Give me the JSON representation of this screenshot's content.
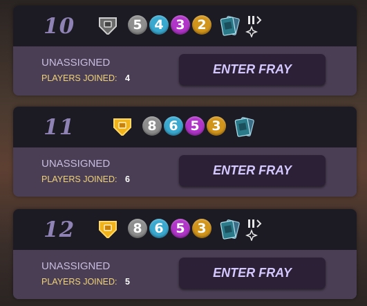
{
  "frays": [
    {
      "number": "10",
      "league_icon": "silver-league-shield-icon",
      "orbs": [
        {
          "value": "5",
          "color": "#8e8e8e"
        },
        {
          "value": "4",
          "color": "#3aa9d0"
        },
        {
          "value": "3",
          "color": "#b035c8"
        },
        {
          "value": "2",
          "color": "#d2951c"
        }
      ],
      "has_ruleset": true,
      "status": "UNASSIGNED",
      "players_label": "PLAYERS JOINED:",
      "players_count": "4",
      "button_label": "ENTER FRAY"
    },
    {
      "number": "11",
      "league_icon": "gold-league-shield-icon",
      "orbs": [
        {
          "value": "8",
          "color": "#8e8e8e"
        },
        {
          "value": "6",
          "color": "#3aa9d0"
        },
        {
          "value": "5",
          "color": "#b035c8"
        },
        {
          "value": "3",
          "color": "#d2951c"
        }
      ],
      "has_ruleset": false,
      "status": "UNASSIGNED",
      "players_label": "PLAYERS JOINED:",
      "players_count": "6",
      "button_label": "ENTER FRAY"
    },
    {
      "number": "12",
      "league_icon": "gold-league-shield-icon",
      "orbs": [
        {
          "value": "8",
          "color": "#8e8e8e"
        },
        {
          "value": "6",
          "color": "#3aa9d0"
        },
        {
          "value": "5",
          "color": "#b035c8"
        },
        {
          "value": "3",
          "color": "#d2951c"
        }
      ],
      "has_ruleset": true,
      "status": "UNASSIGNED",
      "players_label": "PLAYERS JOINED:",
      "players_count": "5",
      "button_label": "ENTER FRAY"
    }
  ],
  "colors": {
    "card_top": "#1c1a22",
    "card_bottom": "#4a3e54",
    "fray_number": "#8f82b4",
    "button_bg": "#2b2036",
    "button_text": "#d5c8ff",
    "players_label": "#f1d37a",
    "silver_league": "#9a9a9a",
    "gold_league": "#f2b21a"
  },
  "icons": {
    "card_deck": "card-deck-icon",
    "ruleset": "ruleset-icon"
  }
}
